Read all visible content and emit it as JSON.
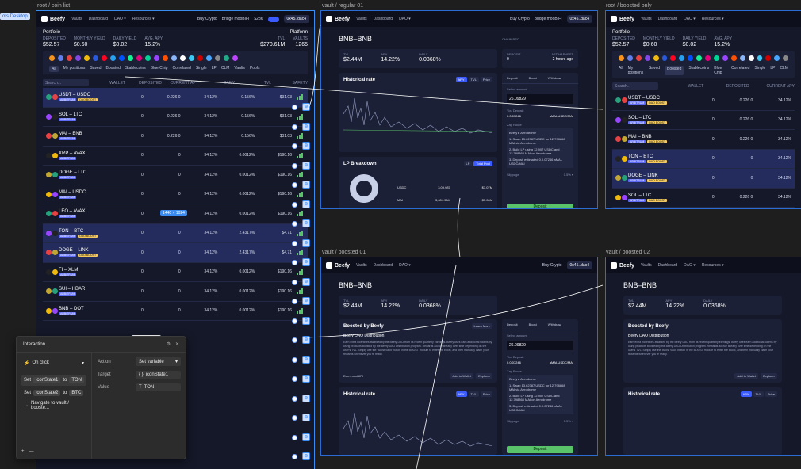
{
  "desk_chip": "ots Desktop",
  "frames": {
    "coin_list": {
      "label": "root / coin list"
    },
    "vault_regular": {
      "label": "vault / regular 01"
    },
    "root_boosted": {
      "label": "root / boosted only"
    },
    "vault_boosted": {
      "label": "vault / boosted 01"
    },
    "vault_boosted2": {
      "label": "vault / boosted 02"
    }
  },
  "nav": {
    "logo": "Beefy",
    "items": [
      "Vaults",
      "Dashboard",
      "DAO ▾",
      "Resources ▾"
    ],
    "buy_crypto": "Buy Crypto",
    "bridge": "Bridge mooBIFI",
    "price": "$286",
    "wallet": "0x45..dac4"
  },
  "portfolio": {
    "title": "Portfolio",
    "platform": "Platform",
    "stats": [
      {
        "label": "DEPOSITED",
        "value": "$52.57"
      },
      {
        "label": "MONTHLY YIELD",
        "value": "$0.60"
      },
      {
        "label": "DAILY YIELD",
        "value": "$0.02"
      },
      {
        "label": "AVG. APY",
        "value": "15.2%"
      }
    ],
    "platform_stats": [
      {
        "label": "TVL",
        "value": "$270.61M"
      },
      {
        "label": "VAULTS",
        "value": "1265"
      }
    ]
  },
  "filters": [
    "All",
    "My positions",
    "Saved",
    "Boosted",
    "Stablecoins",
    "Blue Chip",
    "Correlated",
    "Single",
    "LP",
    "CLM",
    "Vaults",
    "Pools"
  ],
  "filters_boosted_active": "Boosted",
  "search_placeholder": "Search...",
  "columns": [
    "WALLET",
    "DEPOSITED",
    "CURRENT APY",
    "DAILY",
    "TVL",
    "SAFETY"
  ],
  "columns_short": [
    "WALLET",
    "DEPOSITED",
    "CURRENT APY"
  ],
  "tag_boost": "DAO BOOST",
  "tag_chain": "ARBITRUM",
  "vaults": [
    {
      "name": "USDT – USDC",
      "wallet": "0",
      "deposited": "0.226 0",
      "apy": "34.12%",
      "daily": "0.156%",
      "tvl": "$31.03",
      "boosted": true
    },
    {
      "name": "SOL – LTC",
      "wallet": "0",
      "deposited": "0.226 0",
      "apy": "34.12%",
      "daily": "0.156%",
      "tvl": "$31.03",
      "boosted": false
    },
    {
      "name": "MAI – BNB",
      "wallet": "0",
      "deposited": "0.226 0",
      "apy": "34.12%",
      "daily": "0.156%",
      "tvl": "$31.03",
      "boosted": false
    },
    {
      "name": "XRP – AVAX",
      "wallet": "0",
      "deposited": "0",
      "apy": "34.12%",
      "daily": "0.0012%",
      "tvl": "$190.16",
      "boosted": false
    },
    {
      "name": "DOGE – LTC",
      "wallet": "0",
      "deposited": "0",
      "apy": "34.12%",
      "daily": "0.0012%",
      "tvl": "$190.16",
      "boosted": false
    },
    {
      "name": "MAI – USDC",
      "wallet": "0",
      "deposited": "0",
      "apy": "34.12%",
      "daily": "0.0012%",
      "tvl": "$190.16",
      "boosted": false
    },
    {
      "name": "LEO – AVAX",
      "wallet": "0",
      "deposited": "0",
      "apy": "34.12%",
      "daily": "0.0012%",
      "tvl": "$190.16",
      "boosted": false
    },
    {
      "name": "TON – BTC",
      "wallet": "0",
      "deposited": "0",
      "apy": "34.12%",
      "daily": "2.4317%",
      "tvl": "$4.71",
      "boosted": true
    },
    {
      "name": "DOGE – LINK",
      "wallet": "0",
      "deposited": "0",
      "apy": "34.12%",
      "daily": "2.4317%",
      "tvl": "$4.71",
      "boosted": true
    },
    {
      "name": "FI – XLM",
      "wallet": "0",
      "deposited": "0",
      "apy": "34.12%",
      "daily": "0.0012%",
      "tvl": "$190.16",
      "boosted": false
    },
    {
      "name": "SUI – HBAR",
      "wallet": "0",
      "deposited": "0",
      "apy": "34.12%",
      "daily": "0.0012%",
      "tvl": "$190.16",
      "boosted": false
    },
    {
      "name": "BNB – DOT",
      "wallet": "0",
      "deposited": "0",
      "apy": "34.12%",
      "daily": "0.0012%",
      "tvl": "$190.16",
      "boosted": false
    }
  ],
  "boosted_list": [
    {
      "name": "USDT – USDC",
      "wallet": "0",
      "deposited": "0.226 0",
      "apy": "34.12%"
    },
    {
      "name": "SOL – LTC",
      "wallet": "0",
      "deposited": "0.226 0",
      "apy": "34.12%"
    },
    {
      "name": "MAI – BNB",
      "wallet": "0",
      "deposited": "0.226 0",
      "apy": "34.12%"
    },
    {
      "name": "TON – BTC",
      "wallet": "0",
      "deposited": "0",
      "apy": "34.12%"
    },
    {
      "name": "DOGE – LINK",
      "wallet": "0",
      "deposited": "0",
      "apy": "34.12%"
    },
    {
      "name": "SOL – LTC",
      "wallet": "0",
      "deposited": "0.226 0",
      "apy": "34.12%"
    }
  ],
  "size_badge": "1440 × 1024",
  "vault_page": {
    "title": "BNB–BNB",
    "chain_label": "CHAIN BSC",
    "stats": [
      {
        "label": "TVL",
        "value": "$2.44M"
      },
      {
        "label": "APY",
        "value": "14.22%"
      },
      {
        "label": "DAILY",
        "value": "0.0368%"
      }
    ],
    "deposit_stats": [
      {
        "label": "DEPOSIT",
        "value": "0"
      },
      {
        "label": "LAST HARVEST",
        "value": "2 hours ago"
      }
    ],
    "historical_rate": "Historical rate",
    "rate_tabs": [
      "APY",
      "TVL",
      "Price"
    ],
    "lp_breakdown": "LP Breakdown",
    "lp_tabs": [
      "LP",
      "Total Pool"
    ],
    "lp_rows": [
      {
        "asset": "USDC",
        "amount": "3,09.987",
        "value": "$3.07M"
      },
      {
        "asset": "MAI",
        "amount": "3,604.964",
        "value": "$3.06M"
      }
    ],
    "deposit_tabs": [
      "Deposit",
      "Boost",
      "Withdraw"
    ],
    "select_amount": "Select amount",
    "amount_value": "26.09829",
    "you_deposit": "You Deposit",
    "you_deposit_val": "0.0.07246",
    "you_deposit_asset": "aMAI-USDC/MAI",
    "zap_route": "Zap Route",
    "route_name": "Beefy ▸ Aerodrome",
    "route_steps": [
      "1.  Swap 13.62387 USDC for 12.798868 MAI via Aerodrome",
      "2.  Build LP using 12.907 USDC and 12.798868 MAI on Aerodrome",
      "3.  Deposit estimated 0.0.07246 aMAI-USDC/MAI"
    ],
    "slippage": "Slippage",
    "slippage_val": "0.5% ▾",
    "deposit_btn": "Deposit",
    "boost_title": "Boosted by Beefy",
    "boost_sub": "Beefy DAO Distribution",
    "boost_desc": "Earn extra incentives awarded by the Beefy DAO from its recent quarterly earnings. Beefy uses earn additional tokens by using products boosted by the Beefy DAO Distribution program. Rewards accrue linearly over time depending on the user's TVL. Simply use the 'Boost Vault' button in the BOOST module to enter the boost, and then manually claim your rewards whenever you're ready.",
    "earn_label": "Earn mooBIFI",
    "add_wallet": "Add to Wallet",
    "explorer": "Explorer",
    "learn_more": "Learn More"
  },
  "tooltip": {
    "text": "ted Vaults",
    "badge": "⚡"
  },
  "interaction": {
    "title": "Interaction",
    "trigger": "On click",
    "actions": [
      {
        "verb": "Set",
        "var": "iconState1",
        "to": "to",
        "val": "TON"
      },
      {
        "verb": "Set",
        "var": "iconState2",
        "to": "to",
        "val": "BTC"
      },
      {
        "verb": "Navigate to vault / booste...",
        "var": "",
        "to": "",
        "val": ""
      }
    ],
    "action_label": "Action",
    "action_val": "Set variable",
    "target_label": "Target",
    "target_val": "iconState1",
    "value_label": "Value",
    "value_val": "TON",
    "add": "+",
    "remove": "—"
  },
  "colors": {
    "canvas": "#1e1e1e",
    "frame_bg": "#141828",
    "boosted_row": "#232c5c",
    "accent_blue": "#3b8cf0",
    "green": "#59c36a",
    "boost_yellow": "#f4c95d"
  }
}
